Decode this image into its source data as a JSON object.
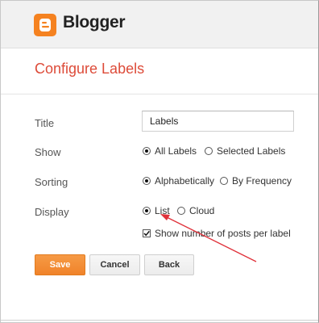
{
  "app": {
    "logo_text": "Blogger",
    "brand_color": "#f58220"
  },
  "page": {
    "title": "Configure Labels",
    "title_color": "#dd4b39"
  },
  "form": {
    "title": {
      "label": "Title",
      "value": "Labels"
    },
    "show": {
      "label": "Show",
      "options": [
        "All Labels",
        "Selected Labels"
      ],
      "selected": "All Labels"
    },
    "sorting": {
      "label": "Sorting",
      "options": [
        "Alphabetically",
        "By Frequency"
      ],
      "selected": "Alphabetically"
    },
    "display": {
      "label": "Display",
      "options": [
        "List",
        "Cloud"
      ],
      "selected": "List"
    },
    "show_counts": {
      "label": "Show number of posts per label",
      "checked": true
    }
  },
  "buttons": {
    "save": "Save",
    "cancel": "Cancel",
    "back": "Back"
  },
  "annotation": {
    "arrow_color": "#e0313a"
  }
}
